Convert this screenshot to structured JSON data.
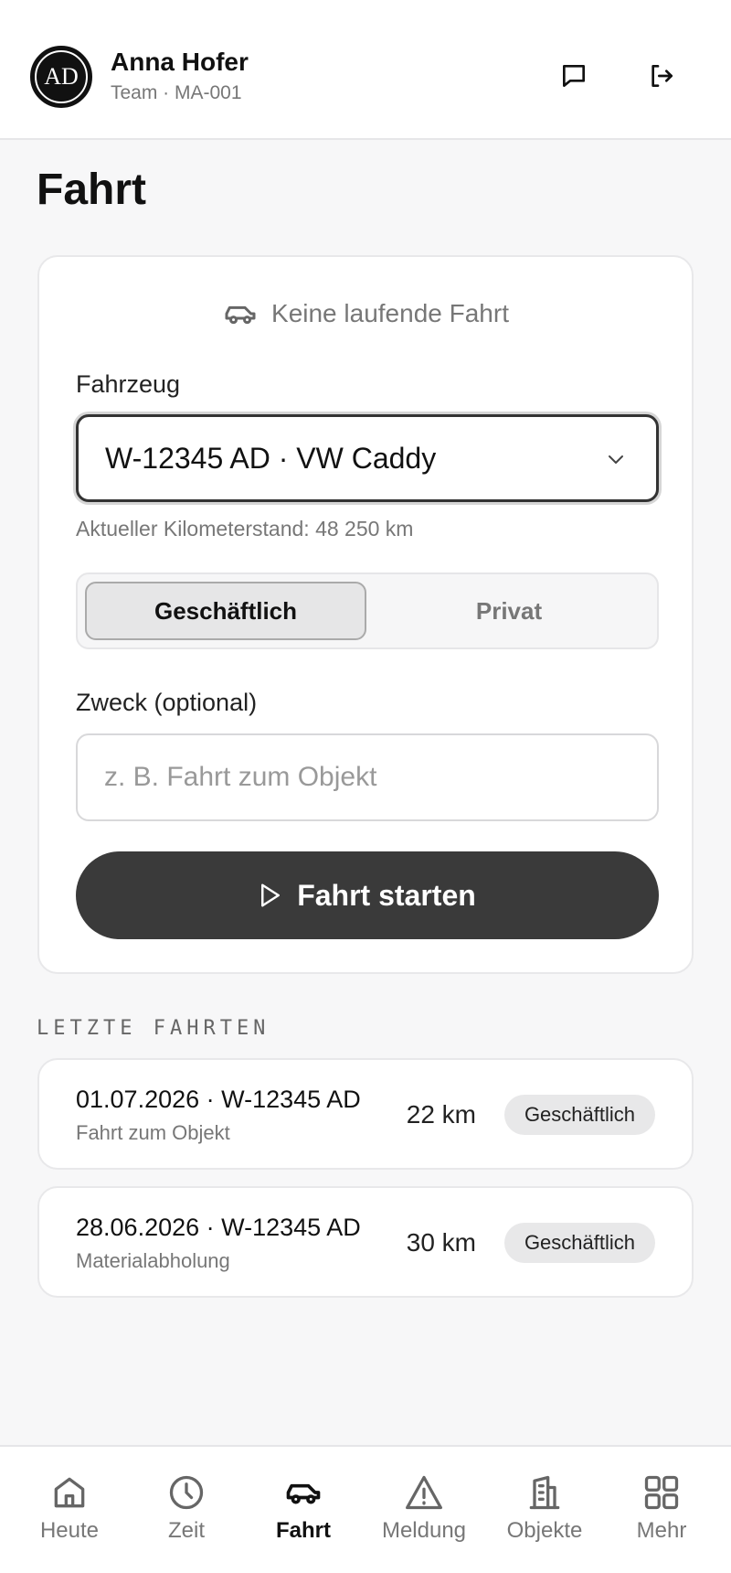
{
  "header": {
    "avatar_initials": "AD",
    "user_name": "Anna Hofer",
    "user_sub": "Team · MA-001",
    "icons": [
      "chat-icon",
      "logout-icon"
    ]
  },
  "page_title": "Fahrt",
  "card": {
    "status_text": "Keine laufende Fahrt",
    "vehicle_label": "Fahrzeug",
    "vehicle_value": "W-12345 AD · VW Caddy",
    "odometer_hint": "Aktueller Kilometerstand: 48 250 km",
    "segment": {
      "options": [
        "Geschäftlich",
        "Privat"
      ],
      "selected": "Geschäftlich"
    },
    "purpose_label": "Zweck (optional)",
    "purpose_placeholder": "z. B. Fahrt zum Objekt",
    "start_button": "Fahrt starten"
  },
  "recent": {
    "title": "LETZTE FAHRTEN",
    "items": [
      {
        "title": "01.07.2026 · W-12345 AD",
        "sub": "Fahrt zum Objekt",
        "km": "22 km",
        "badge": "Geschäftlich"
      },
      {
        "title": "28.06.2026 · W-12345 AD",
        "sub": "Materialabholung",
        "km": "30 km",
        "badge": "Geschäftlich"
      }
    ]
  },
  "tabbar": {
    "active": "Fahrt",
    "items": [
      {
        "label": "Heute",
        "icon": "home-icon"
      },
      {
        "label": "Zeit",
        "icon": "clock-icon"
      },
      {
        "label": "Fahrt",
        "icon": "car-icon"
      },
      {
        "label": "Meldung",
        "icon": "warning-icon"
      },
      {
        "label": "Objekte",
        "icon": "building-icon"
      },
      {
        "label": "Mehr",
        "icon": "grid-icon"
      }
    ]
  },
  "colors": {
    "primary_button": "#3a3a3a",
    "background": "#f7f7f8",
    "muted_text": "#777777"
  }
}
